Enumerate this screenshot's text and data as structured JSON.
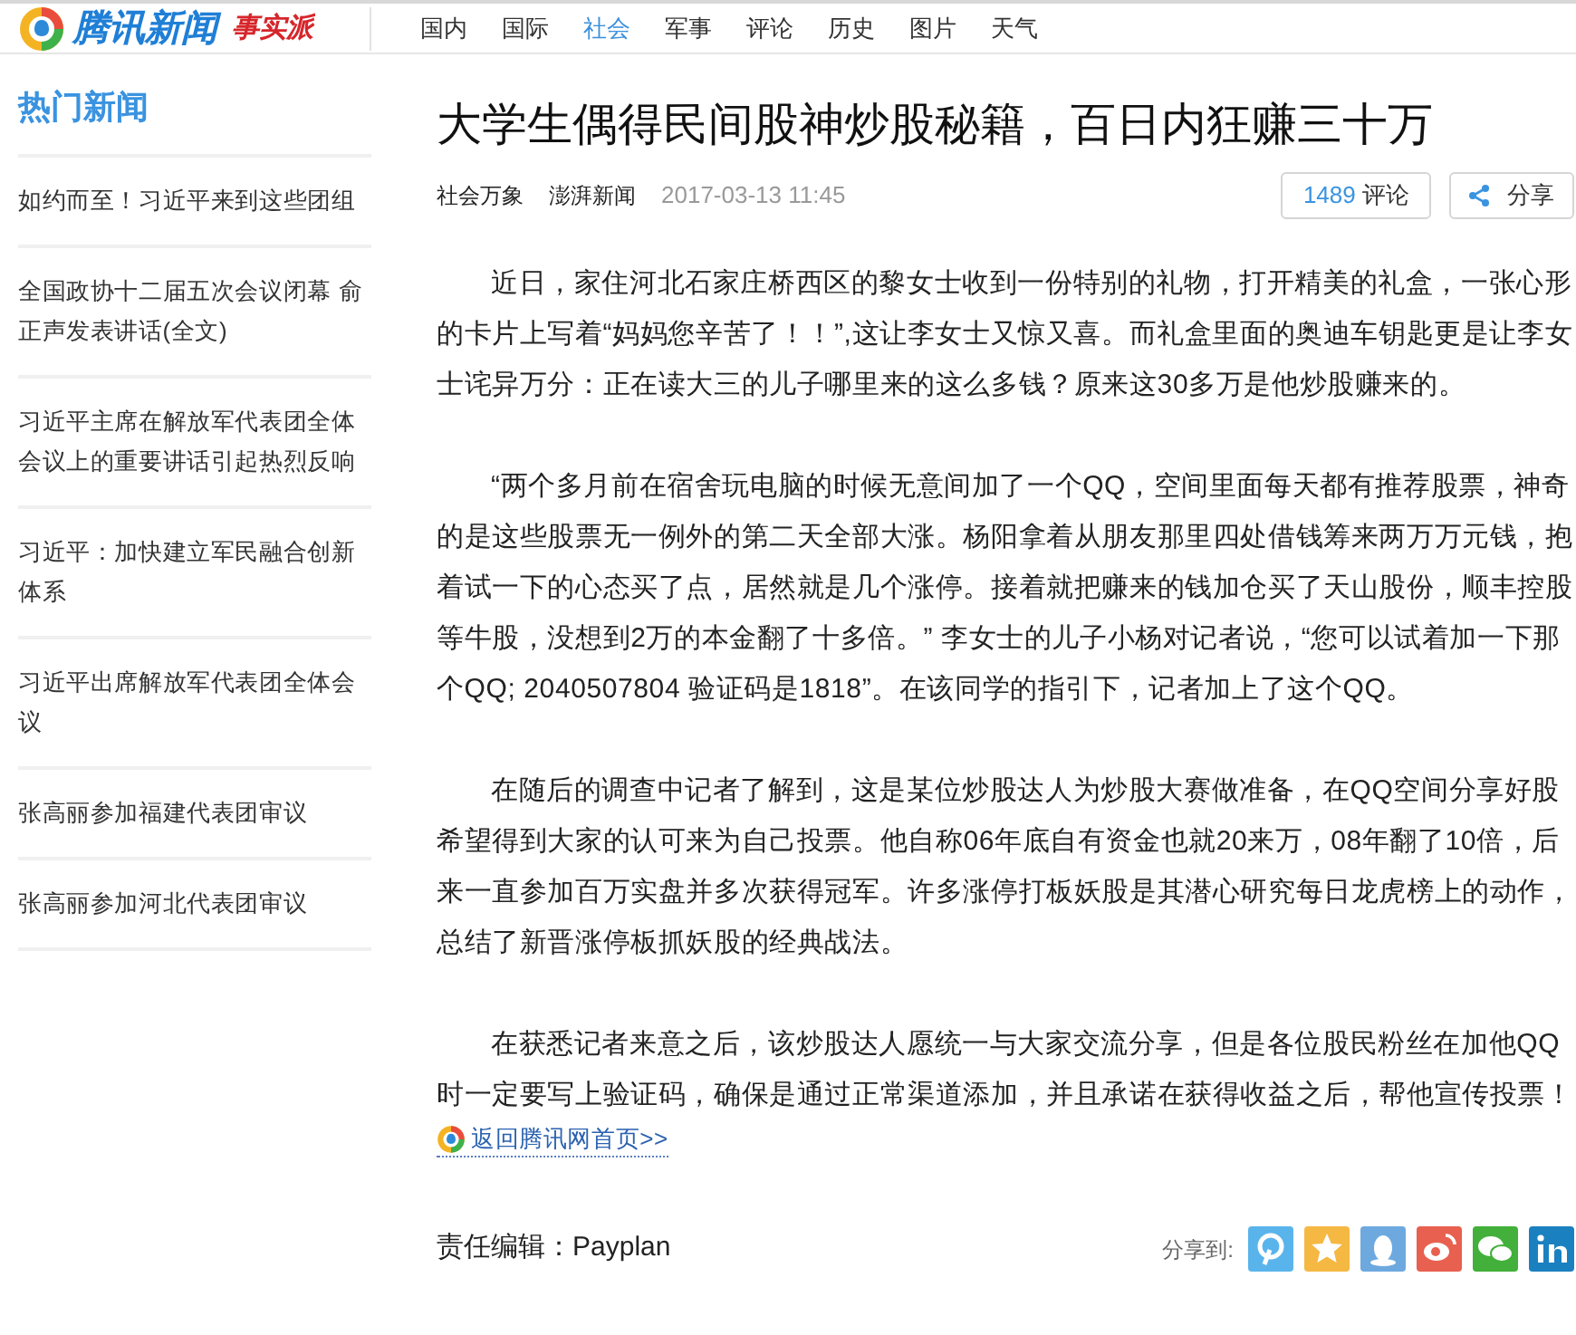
{
  "header": {
    "logo_text": "腾讯新闻",
    "channel_badge": "事实派",
    "nav": [
      {
        "label": "国内",
        "selected": false
      },
      {
        "label": "国际",
        "selected": false
      },
      {
        "label": "社会",
        "selected": true
      },
      {
        "label": "军事",
        "selected": false
      },
      {
        "label": "评论",
        "selected": false
      },
      {
        "label": "历史",
        "selected": false
      },
      {
        "label": "图片",
        "selected": false
      },
      {
        "label": "天气",
        "selected": false
      }
    ]
  },
  "sidebar": {
    "title": "热门新闻",
    "items": [
      "如约而至！习近平来到这些团组",
      "全国政协十二届五次会议闭幕 俞正声发表讲话(全文)",
      "习近平主席在解放军代表团全体会议上的重要讲话引起热烈反响",
      "习近平：加快建立军民融合创新体系",
      "习近平出席解放军代表团全体会议",
      "张高丽参加福建代表团审议",
      "张高丽参加河北代表团审议"
    ]
  },
  "article": {
    "title": "大学生偶得民间股神炒股秘籍，百日内狂赚三十万",
    "category": "社会万象",
    "source": "澎湃新闻",
    "time": "2017-03-13 11:45",
    "comment_count": "1489",
    "comment_label": "评论",
    "share_label": "分享",
    "paragraphs": [
      "近日，家住河北石家庄桥西区的黎女士收到一份特别的礼物，打开精美的礼盒，一张心形的卡片上写着“妈妈您辛苦了！！”,这让李女士又惊又喜。而礼盒里面的奥迪车钥匙更是让李女士诧异万分：正在读大三的儿子哪里来的这么多钱？原来这30多万是他炒股赚来的。",
      "“两个多月前在宿舍玩电脑的时候无意间加了一个QQ，空间里面每天都有推荐股票，神奇的是这些股票无一例外的第二天全部大涨。杨阳拿着从朋友那里四处借钱筹来两万万元钱，抱着试一下的心态买了点，居然就是几个涨停。接着就把赚来的钱加仓买了天山股份，顺丰控股等牛股，没想到2万的本金翻了十多倍。” 李女士的儿子小杨对记者说，“您可以试着加一下那个QQ; 2040507804  验证码是1818”。在该同学的指引下，记者加上了这个QQ。",
      "在随后的调查中记者了解到，这是某位炒股达人为炒股大赛做准备，在QQ空间分享好股希望得到大家的认可来为自己投票。他自称06年底自有资金也就20来万，08年翻了10倍，后来一直参加百万实盘并多次获得冠军。许多涨停打板妖股是其潜心研究每日龙虎榜上的动作，总结了新晋涨停板抓妖股的经典战法。",
      "在获悉记者来意之后，该炒股达人愿统一与大家交流分享，但是各位股民粉丝在加他QQ时一定要写上验证码，确保是通过正常渠道添加，并且承诺在获得收益之后，帮他宣传投票！"
    ],
    "home_link": "返回腾讯网首页>>",
    "editor": "责任编辑：Payplan",
    "share_to": "分享到:"
  }
}
